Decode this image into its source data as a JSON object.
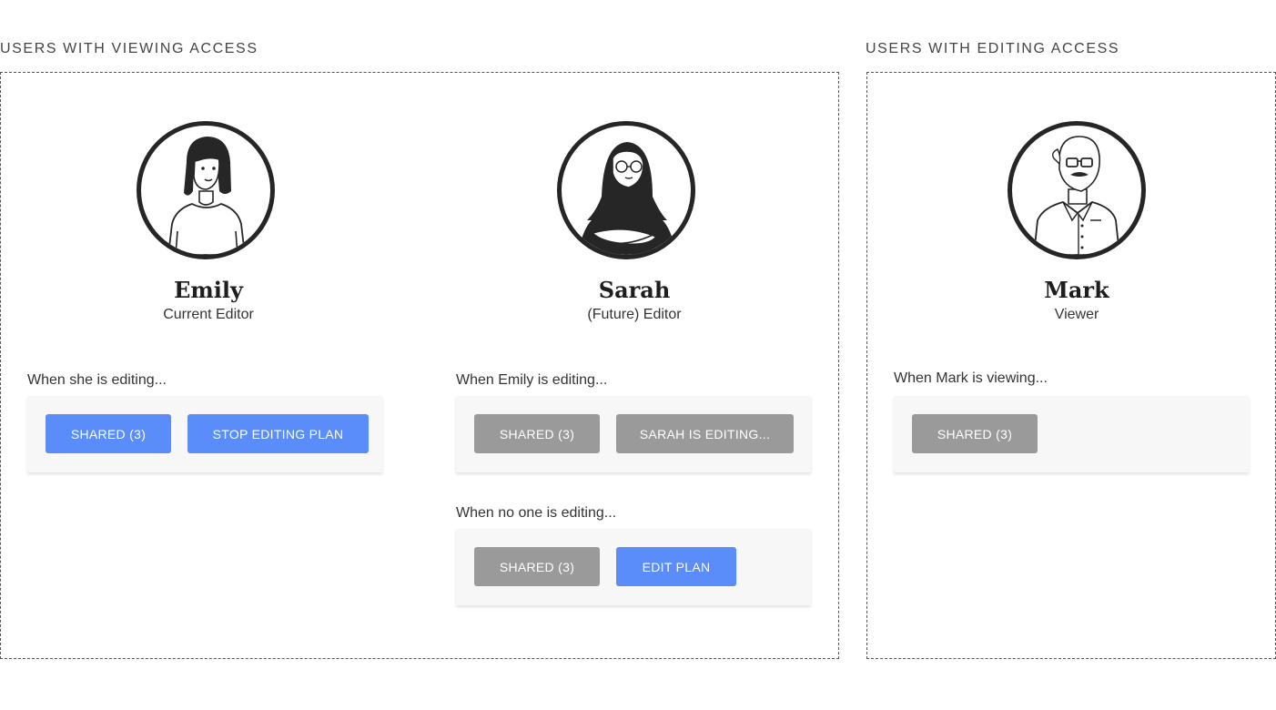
{
  "sections": {
    "viewing": {
      "title": "USERS WITH VIEWING ACCESS"
    },
    "editing": {
      "title": "USERS WITH EDITING ACCESS"
    }
  },
  "people": {
    "emily": {
      "name": "Emily",
      "role": "Current Editor",
      "scenarios": [
        {
          "caption": "When she is editing...",
          "buttons": [
            "SHARED (3)",
            "STOP EDITING PLAN"
          ]
        }
      ]
    },
    "sarah": {
      "name": "Sarah",
      "role": "(Future) Editor",
      "scenarios": [
        {
          "caption": "When Emily is editing...",
          "buttons": [
            "SHARED (3)",
            "SARAH IS EDITING..."
          ]
        },
        {
          "caption": "When no one is editing...",
          "buttons": [
            "SHARED (3)",
            "EDIT PLAN"
          ]
        }
      ]
    },
    "mark": {
      "name": "Mark",
      "role": "Viewer",
      "scenarios": [
        {
          "caption": "When Mark is viewing...",
          "buttons": [
            "SHARED (3)"
          ]
        }
      ]
    }
  },
  "colors": {
    "primary_button": "#5b8dfa",
    "disabled_button": "#9a9a9a",
    "panel_background": "#f7f7f7",
    "avatar_ring": "#262626"
  },
  "icons": {
    "emily_avatar": "woman-short-hair-illustration",
    "sarah_avatar": "woman-hijab-glasses-illustration",
    "mark_avatar": "old-man-glasses-mustache-illustration"
  }
}
